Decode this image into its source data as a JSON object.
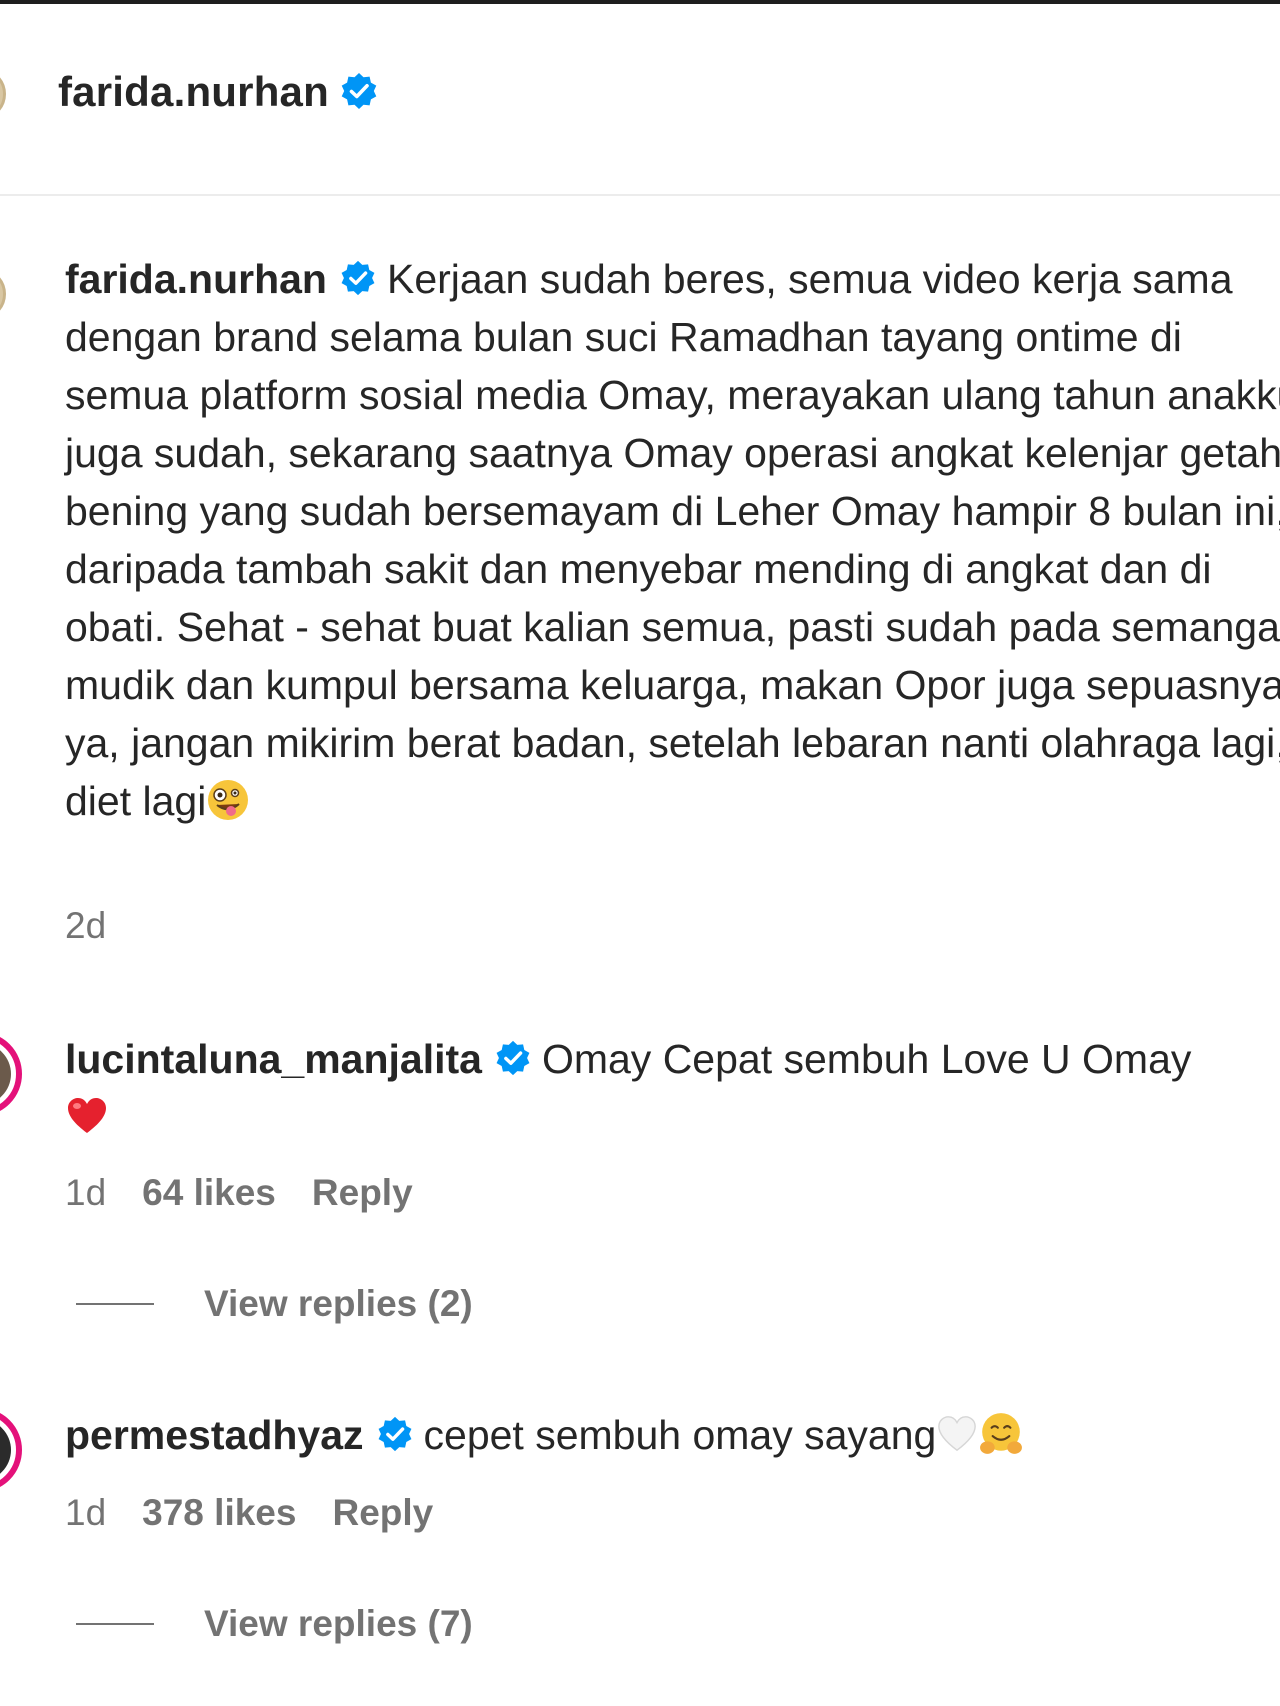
{
  "header": {
    "username": "farida.nurhan"
  },
  "caption": {
    "username": "farida.nurhan",
    "text": "Kerjaan sudah beres, semua video kerja sama dengan brand selama bulan suci Ramadhan tayang ontime di semua platform sosial media Omay, merayakan ulang tahun anakku juga sudah, sekarang saatnya Omay operasi angkat kelenjar getah bening yang sudah bersemayam di Leher Omay hampir 8 bulan ini, daripada tambah sakit dan menyebar mending di angkat dan di obati. Sehat - sehat buat kalian semua, pasti sudah pada semangat mudik dan kumpul bersama keluarga, makan Opor juga sepuasnya ya, jangan mikirim berat badan, setelah lebaran nanti olahraga lagi, diet lagi",
    "time": "2d"
  },
  "comments": [
    {
      "username": "lucintaluna_manjalita",
      "text": "Omay Cepat sembuh Love U Omay",
      "time": "1d",
      "likes": "64 likes",
      "reply_label": "Reply",
      "view_replies": "View replies (2)"
    },
    {
      "username": "permestadhyaz",
      "text": "cepet sembuh omay sayang",
      "time": "1d",
      "likes": "378 likes",
      "reply_label": "Reply",
      "view_replies": "View replies (7)"
    }
  ],
  "colors": {
    "verified": "#0095f6",
    "story_ring": "#e4117a",
    "text": "#262626",
    "meta": "#737373"
  }
}
